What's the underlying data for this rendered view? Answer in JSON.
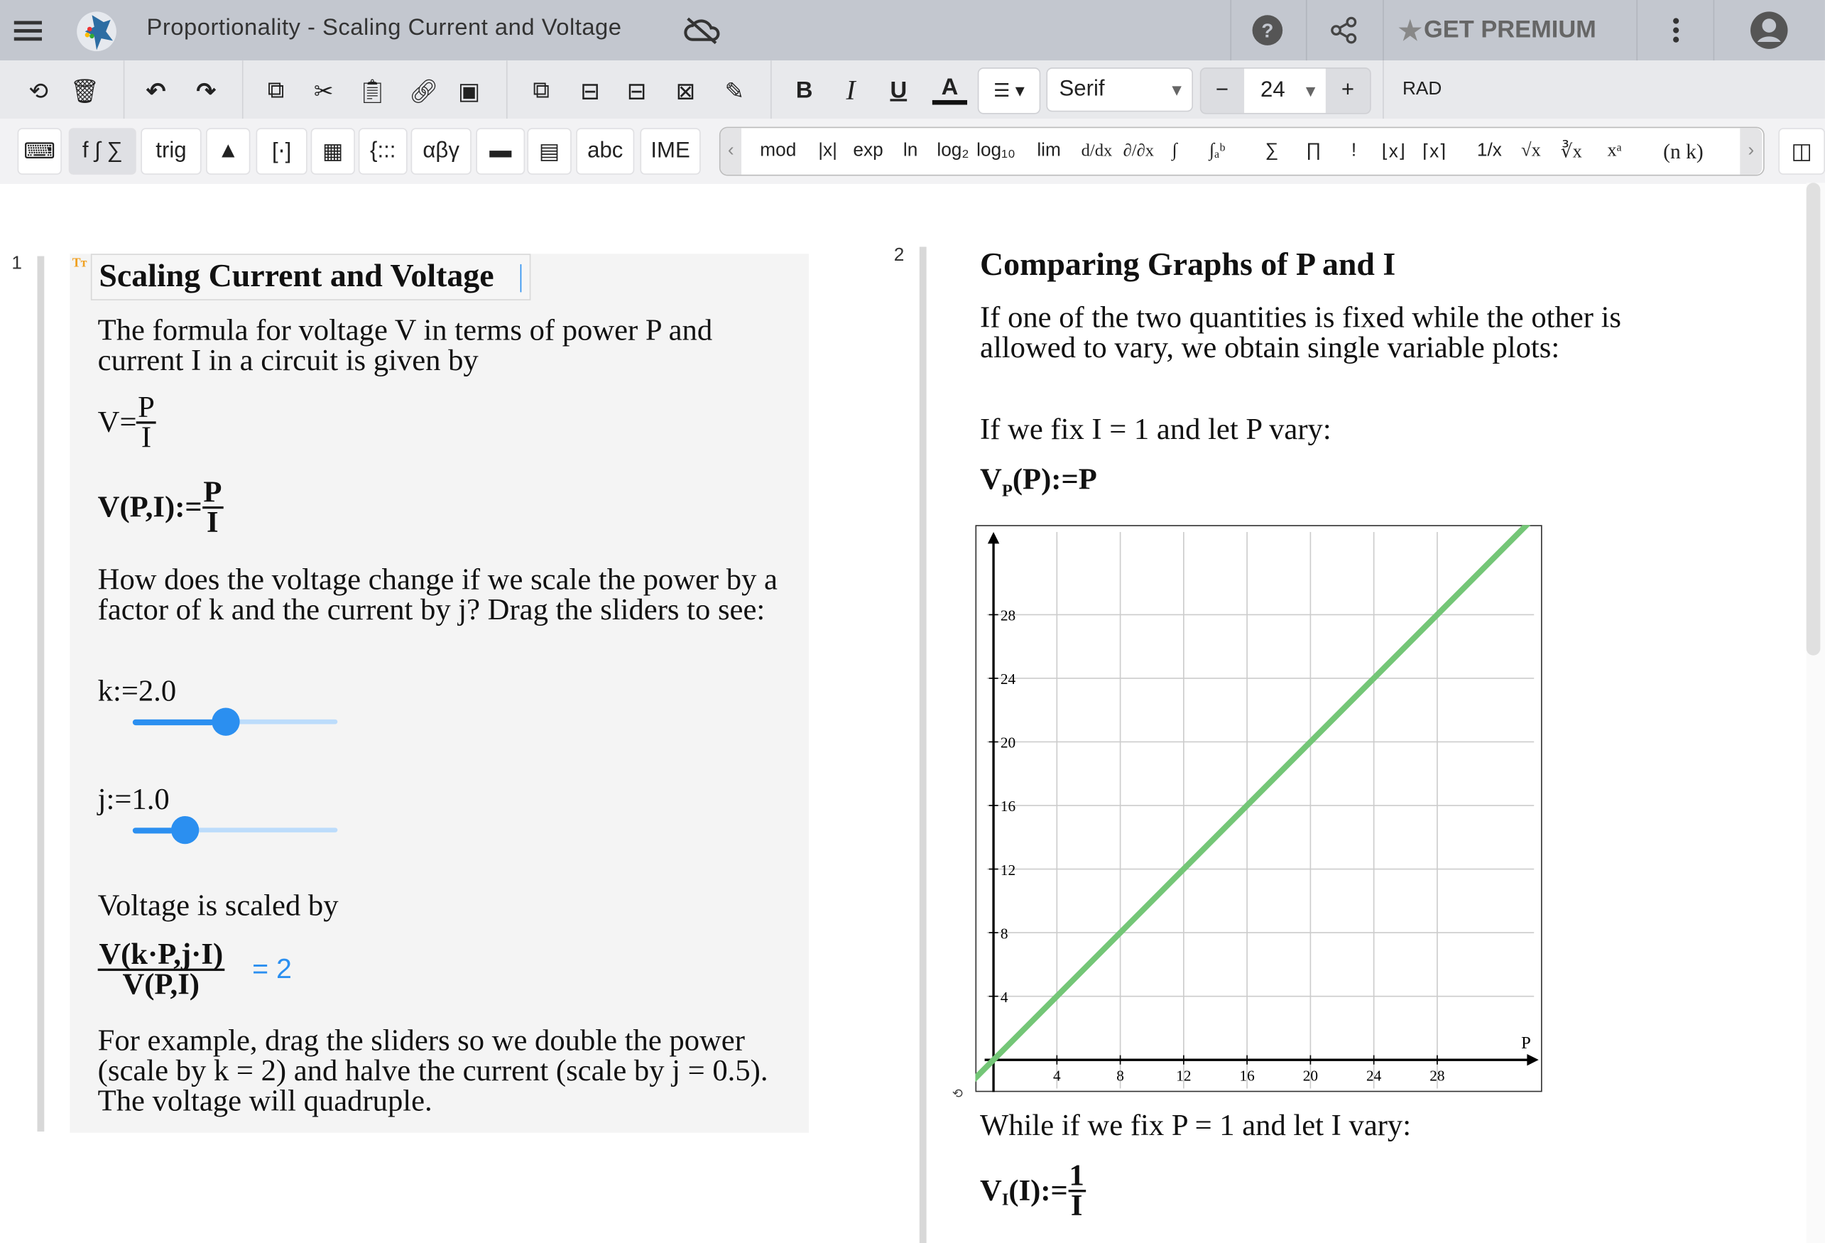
{
  "app": {
    "title": "Proportionality - Scaling Current and Voltage",
    "premium_label": "GET PREMIUM",
    "icons": [
      "menu-icon",
      "app-logo",
      "cloud-off-icon",
      "help-icon",
      "share-icon",
      "star-icon",
      "more-vert-icon",
      "account-icon"
    ]
  },
  "toolbar": {
    "font_family": "Serif",
    "font_size": "24",
    "minus": "−",
    "plus": "+",
    "angle_mode": "RAD",
    "bold": "B",
    "italic": "I",
    "underline": "U",
    "color": "A"
  },
  "keyboard_tabs": [
    "f ∫ ∑",
    "trig",
    "[⋅]",
    "{:::",
    "αβγ",
    "abc",
    "IME"
  ],
  "math_buttons": [
    "mod",
    "|x|",
    "exp",
    "ln",
    "log₂",
    "log₁₀",
    "lim",
    "d/dx",
    "∂/∂x",
    "∫",
    "∫ₐᵇ",
    "∑",
    "∏",
    "!",
    "⌊x⌋",
    "⌈x⌉",
    "1/x",
    "√x",
    "∛x",
    "xᵃ",
    "(n k)"
  ],
  "pages": [
    {
      "number": "1",
      "heading": "Scaling Current and Voltage",
      "intro": "The formula for voltage V in terms of power P and current I in a circuit is given by",
      "eq1_lhs": "V=",
      "eq1_num": "P",
      "eq1_den": "I",
      "eq2_lhs": "V(P,I):=",
      "eq2_num": "P",
      "eq2_den": "I",
      "question": "How does the voltage change if we scale the power by a factor of k and the current by j? Drag the sliders to see:",
      "slider_k": {
        "label": "k:=2.0",
        "value": 2.0,
        "min": 0,
        "max": 5
      },
      "slider_j": {
        "label": "j:=1.0",
        "value": 1.0,
        "min": 0,
        "max": 5
      },
      "scaled_label": "Voltage is scaled by",
      "ratio_num": "V(k·P,j·I)",
      "ratio_den": "V(P,I)",
      "ratio_result": "= 2",
      "example": "For example, drag the sliders so we double the power (scale by k = 2) and halve the current (scale by j = 0.5). The voltage will quadruple."
    },
    {
      "number": "2",
      "heading": "Comparing Graphs of P and I",
      "intro": "If one of the two quantities is fixed while the other is allowed to vary, we obtain single variable plots:",
      "fix_i": "If we fix I = 1 and let P vary:",
      "vp_def": "V",
      "vp_sub": "P",
      "vp_rest": "(P):=P",
      "fix_p": "While if we fix P = 1 and let I vary:",
      "vi_def": "V",
      "vi_sub": "I",
      "vi_rest": "(I):=",
      "vi_num": "1",
      "vi_den": "I"
    }
  ],
  "chart_data": {
    "type": "line",
    "xlabel": "P",
    "ylabel": "",
    "xlim": [
      -1,
      34.4
    ],
    "ylim": [
      -1.8,
      33.2
    ],
    "xticks": [
      4,
      8,
      12,
      16,
      20,
      24,
      28
    ],
    "yticks": [
      4,
      8,
      12,
      16,
      20,
      24,
      28
    ],
    "grid": true,
    "series": [
      {
        "name": "V_P(P)=P",
        "color": "#74c677",
        "points": [
          [
            -1.8,
            -1.8
          ],
          [
            34.3,
            34.3
          ]
        ]
      }
    ]
  }
}
